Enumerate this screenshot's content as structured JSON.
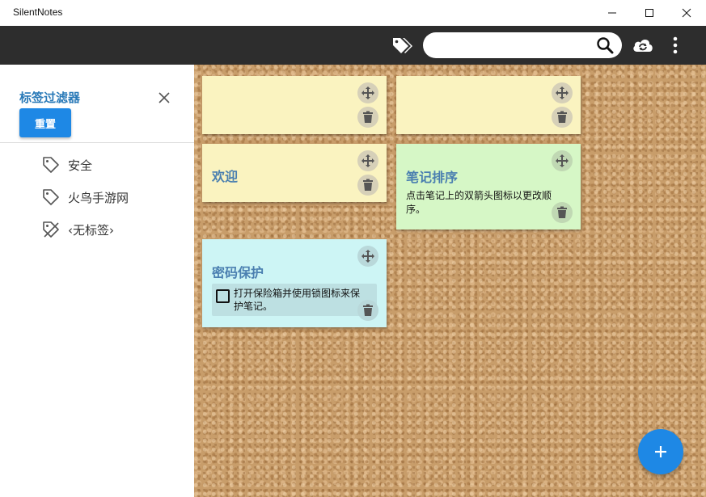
{
  "window": {
    "title": "SilentNotes"
  },
  "toolbar": {
    "search": {
      "value": "",
      "placeholder": ""
    }
  },
  "sidebar": {
    "title": "标签过滤器",
    "reset_label": "重置",
    "tags": [
      {
        "label": "安全"
      },
      {
        "label": "火鸟手游网"
      },
      {
        "label": "‹无标签›"
      }
    ]
  },
  "notes": [
    {
      "title": "",
      "body": "",
      "color": "#faf3c0"
    },
    {
      "title": "",
      "body": "",
      "color": "#faf3c0"
    },
    {
      "title": "欢迎",
      "body": "",
      "color": "#faf3c0"
    },
    {
      "title": "笔记排序",
      "body": "点击笔记上的双箭头图标以更改顺序。",
      "color": "#d6f7c6"
    },
    {
      "title": "密码保护",
      "checklist": [
        {
          "text": "打开保险箱并使用锁图标来保护笔记。",
          "checked": false
        }
      ],
      "color": "#cdf5f5"
    }
  ],
  "colors": {
    "accent": "#1e88e5",
    "toolbar": "#2d2d2d",
    "title_blue": "#2a7ab8"
  },
  "icons": {
    "tag_filter": "tags-icon",
    "search": "search-icon",
    "sync": "cloud-sync-icon",
    "menu": "more-vertical-icon",
    "move": "move-icon",
    "delete": "trash-icon",
    "add": "plus-icon"
  }
}
